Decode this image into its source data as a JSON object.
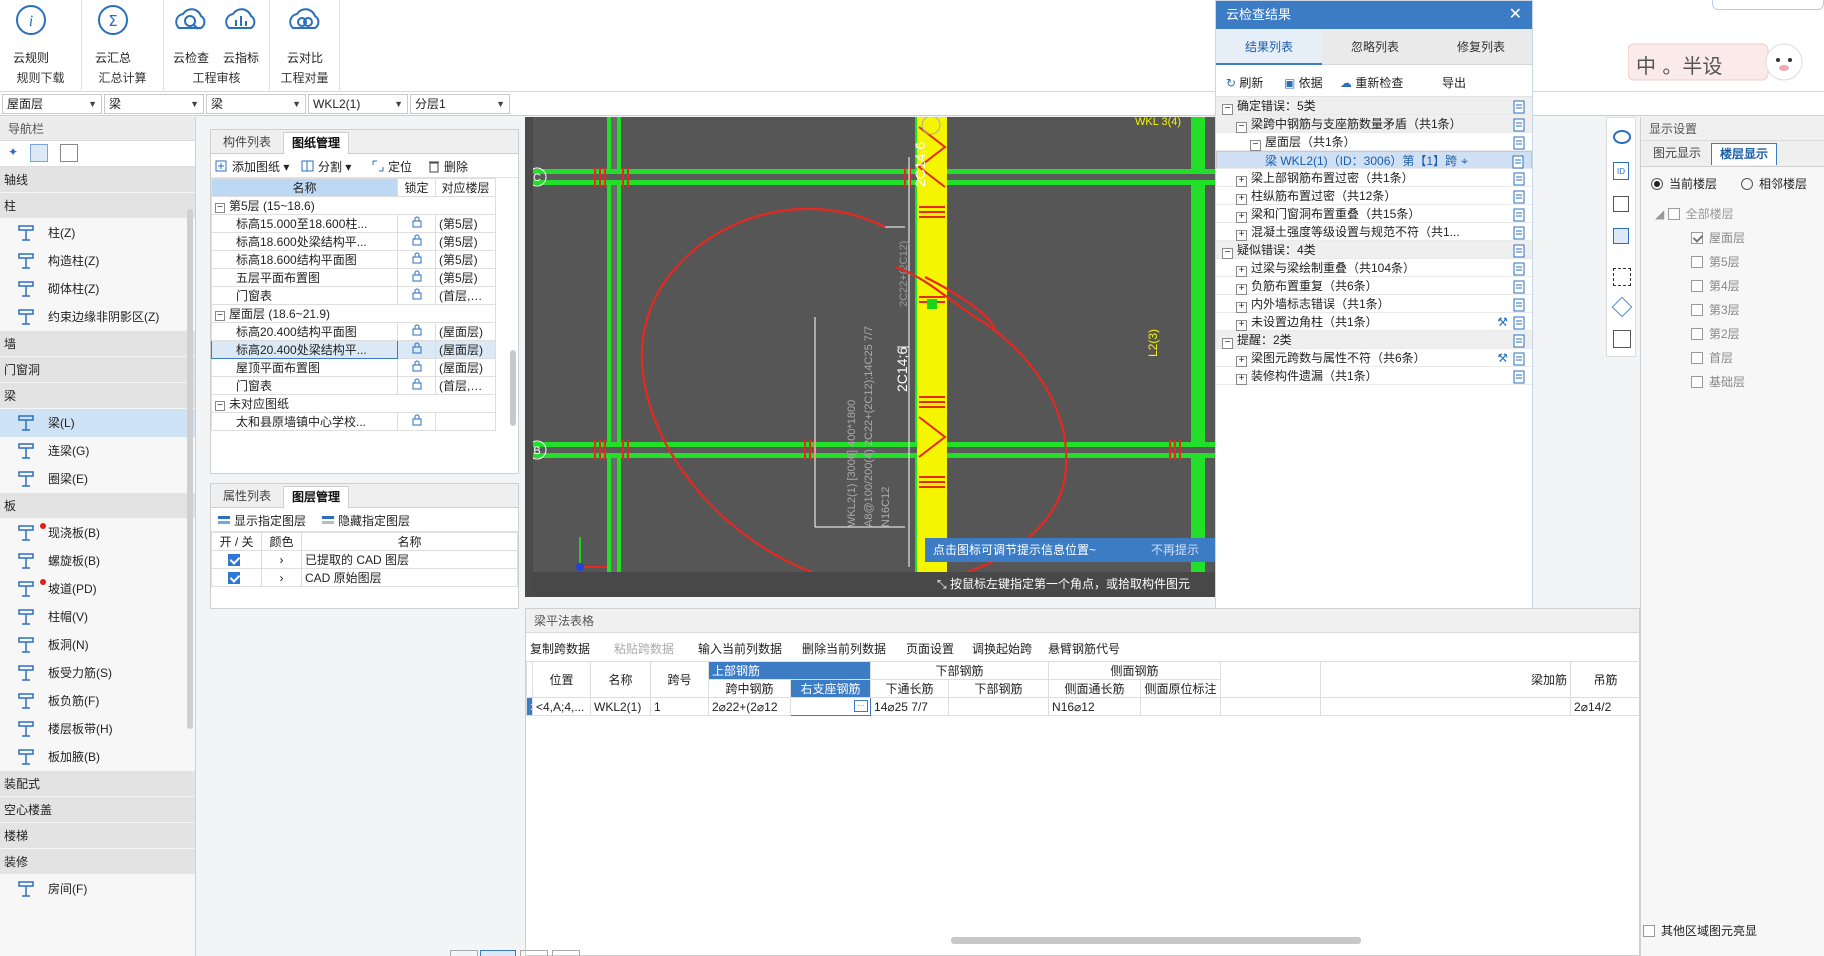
{
  "ribbon": {
    "groups": [
      {
        "label": "规则下载",
        "buttons": [
          {
            "label": "云规则",
            "icon": "info-cloud-icon"
          }
        ]
      },
      {
        "label": "汇总计算",
        "buttons": [
          {
            "label": "云汇总",
            "icon": "sigma-cloud-icon"
          }
        ]
      },
      {
        "label": "工程审核",
        "buttons": [
          {
            "label": "云检查",
            "icon": "search-cloud-icon"
          },
          {
            "label": "云指标",
            "icon": "chart-cloud-icon"
          }
        ]
      },
      {
        "label": "工程对量",
        "buttons": [
          {
            "label": "云对比",
            "icon": "compare-cloud-icon"
          }
        ]
      }
    ]
  },
  "selectors": [
    "屋面层",
    "梁",
    "梁",
    "WKL2(1)",
    "分层1"
  ],
  "nav": {
    "title": "导航栏",
    "categories": [
      {
        "label": "轴线",
        "items": []
      },
      {
        "label": "柱",
        "items": [
          "柱(Z)",
          "构造柱(Z)",
          "砌体柱(Z)",
          "约束边缘非阴影区(Z)"
        ]
      },
      {
        "label": "墙",
        "items": []
      },
      {
        "label": "门窗洞",
        "items": []
      },
      {
        "label": "梁",
        "items": [
          "梁(L)",
          "连梁(G)",
          "圈梁(E)"
        ]
      },
      {
        "label": "板",
        "items": [
          "现浇板(B)",
          "螺旋板(B)",
          "坡道(PD)",
          "柱帽(V)",
          "板洞(N)",
          "板受力筋(S)",
          "板负筋(F)",
          "楼层板带(H)",
          "板加腋(B)"
        ]
      },
      {
        "label": "装配式",
        "items": []
      },
      {
        "label": "空心楼盖",
        "items": []
      },
      {
        "label": "楼梯",
        "items": []
      },
      {
        "label": "装修",
        "items": [
          "房间(F)"
        ]
      }
    ]
  },
  "drawing": {
    "tabs": [
      "构件列表",
      "图纸管理"
    ],
    "tools": [
      "添加图纸",
      "分割",
      "定位",
      "删除"
    ],
    "headers": [
      "名称",
      "锁定",
      "对应楼层"
    ],
    "rows": [
      {
        "type": "group",
        "name": "第5层 (15~18.6)"
      },
      {
        "type": "item",
        "name": "标高15.000至18.600柱...",
        "floor": "(第5层)"
      },
      {
        "type": "item",
        "name": "标高18.600处梁结构平...",
        "floor": "(第5层)"
      },
      {
        "type": "item",
        "name": "标高18.600结构平面图",
        "floor": "(第5层)"
      },
      {
        "type": "item",
        "name": "五层平面布置图",
        "floor": "(第5层)"
      },
      {
        "type": "item",
        "name": "门窗表",
        "floor": "(首层,第..."
      },
      {
        "type": "group",
        "name": "屋面层 (18.6~21.9)"
      },
      {
        "type": "item",
        "name": "标高20.400结构平面图",
        "floor": "(屋面层)"
      },
      {
        "type": "item",
        "name": "标高20.400处梁结构平...",
        "floor": "(屋面层)",
        "selected": true
      },
      {
        "type": "item",
        "name": "屋顶平面布置图",
        "floor": "(屋面层)"
      },
      {
        "type": "item",
        "name": "门窗表",
        "floor": "(首层,第..."
      },
      {
        "type": "group",
        "name": "未对应图纸"
      },
      {
        "type": "item",
        "name": "太和县原墙镇中心学校...",
        "floor": ""
      }
    ]
  },
  "layers": {
    "tabs": [
      "属性列表",
      "图层管理"
    ],
    "tools": [
      "显示指定图层",
      "隐藏指定图层"
    ],
    "headers": [
      "开 / 关",
      "颜色",
      "名称"
    ],
    "rows": [
      "已提取的 CAD 图层",
      "CAD 原始图层"
    ]
  },
  "canvas": {
    "axis_labels": [
      "C",
      "B",
      "B"
    ],
    "texts": [
      "2C14;6",
      "2C14;6",
      "2C22+(2C12)",
      "WKL2(1) [3006] 400*1800",
      "A8@100/200(4) 2C22+(2C12);14C25 7/7",
      "N16C12",
      "L2(3)",
      "WKL 3(4)"
    ],
    "hint": "点击图标可调节提示信息位置~",
    "hint_dismiss": "不再提示",
    "status": "按鼠标左键指定第一个角点，或拾取构件图元"
  },
  "cloud": {
    "title": "云检查结果",
    "tabs": [
      "结果列表",
      "忽略列表",
      "修复列表"
    ],
    "actions": [
      "刷新",
      "依据",
      "重新检查",
      "导出"
    ],
    "rows": [
      {
        "level": 0,
        "label": "确定错误：5类",
        "pm": "−",
        "grey": true
      },
      {
        "level": 1,
        "label": "梁跨中钢筋与支座筋数量矛盾（共1条）",
        "pm": "−",
        "grey": true
      },
      {
        "level": 2,
        "label": "屋面层（共1条）",
        "pm": "−",
        "grey": false
      },
      {
        "level": 3,
        "label": "梁 WKL2(1)（ID：3006）第【1】跨",
        "pm": "",
        "sel": true
      },
      {
        "level": 1,
        "label": "梁上部钢筋布置过密（共1条）",
        "pm": "+",
        "grey": false
      },
      {
        "level": 1,
        "label": "柱纵筋布置过密（共12条）",
        "pm": "+",
        "grey": false
      },
      {
        "level": 1,
        "label": "梁和门窗洞布置重叠（共15条）",
        "pm": "+",
        "grey": false
      },
      {
        "level": 1,
        "label": "混凝土强度等级设置与规范不符（共1...",
        "pm": "+",
        "grey": false
      },
      {
        "level": 0,
        "label": "疑似错误：4类",
        "pm": "−",
        "grey": true
      },
      {
        "level": 1,
        "label": "过梁与梁绘制重叠（共104条）",
        "pm": "+",
        "grey": false
      },
      {
        "level": 1,
        "label": "负筋布置重复（共6条）",
        "pm": "+",
        "grey": false
      },
      {
        "level": 1,
        "label": "内外墙标志错误（共1条）",
        "pm": "+",
        "grey": false
      },
      {
        "level": 1,
        "label": "未设置边角柱（共1条）",
        "pm": "+",
        "grey": false,
        "wrench": true
      },
      {
        "level": 0,
        "label": "提醒：2类",
        "pm": "−",
        "grey": true
      },
      {
        "level": 1,
        "label": "梁图元跨数与属性不符（共6条）",
        "pm": "+",
        "grey": false,
        "wrench": true
      },
      {
        "level": 1,
        "label": "装修构件遗漏（共1条）",
        "pm": "+",
        "grey": false
      }
    ]
  },
  "beam_table": {
    "title": "梁平法表格",
    "tools": [
      "复制跨数据",
      "粘贴跨数据",
      "输入当前列数据",
      "删除当前列数据",
      "页面设置",
      "调换起始跨",
      "悬臂钢筋代号"
    ],
    "group_headers": [
      "上部钢筋",
      "下部钢筋",
      "侧面钢筋"
    ],
    "headers": [
      "位置",
      "名称",
      "跨号",
      "跨中钢筋",
      "右支座钢筋",
      "下通长筋",
      "下部钢筋",
      "侧面通长筋",
      "侧面原位标注",
      "梁加筋",
      "吊筋"
    ],
    "row": [
      "<4,A;4,...",
      "WKL2(1)",
      "1",
      "2⌀22+(2⌀12",
      "",
      "14⌀25 7/7",
      "",
      "N16⌀12",
      "",
      "",
      "2⌀14/2"
    ],
    "row_index": "1"
  },
  "display": {
    "title": "显示设置",
    "tabs": [
      "图元显示",
      "楼层显示"
    ],
    "radios": [
      "当前楼层",
      "相邻楼层"
    ],
    "all_floors": "全部楼层",
    "floors": [
      "屋面层",
      "第5层",
      "第4层",
      "第3层",
      "第2层",
      "首层",
      "基础层"
    ],
    "other": "其他区域图元亮显"
  },
  "logo_text": "中 。半设",
  "colors": {
    "accent": "#3c7cc5",
    "beam_green": "#22e02a",
    "beam_yellow": "#f5f500",
    "annot_red": "#e8281e"
  }
}
